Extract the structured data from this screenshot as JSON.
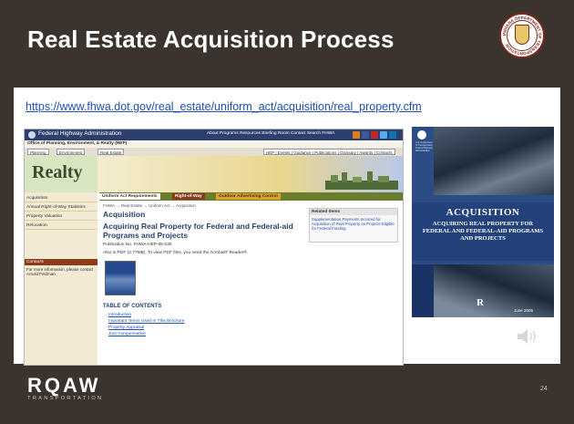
{
  "slide": {
    "title": "Real Estate Acquisition Process",
    "url": "https://www.fhwa.dot.gov/real_estate/uniform_act/acquisition/real_property.cfm",
    "page_number": "24",
    "footer_logo_text": "RQAW",
    "footer_tagline": "TRANSPORTATION",
    "seal_text": "INDIANA DEPARTMENT OF TRANSPORTATION"
  },
  "webpage": {
    "agency": "Federal Highway Administration",
    "top_links": "About  Programs  Resources  Briefing Room  Contact  Search FHWA",
    "office": "Office of Planning, Environment, & Realty (HEP)",
    "tabs": [
      "Planning",
      "Environment",
      "Real Estate"
    ],
    "right_tabs": "HEP | Events | Guidance | Publications | Glossary | Awards | Contacts",
    "banner_title": "Realty",
    "sidebar": [
      "Acquisition",
      "Annual Right-of-Way Statistics",
      "Property Valuation",
      "Relocation"
    ],
    "sidebar_contacts": "Contacts",
    "sidebar_note": "For more information, please contact Arnold Feldman",
    "subtabs": [
      "Uniform Act Requirements",
      "Right-of-Way",
      "Outdoor Advertising Control"
    ],
    "breadcrumb": "FHWA → Real Estate → Uniform Act → Acquisition",
    "heading": "Acquisition",
    "page_title": "Acquiring Real Property for Federal and Federal-aid Programs and Projects",
    "publication": "Publication No. FHWA-HEP-05-030",
    "also_in": "Also in PDF (2.77MB). To view PDF files, you need the Acrobat® Reader®.",
    "toc_title": "TABLE OF CONTENTS",
    "toc_items": [
      "Introduction",
      "Important Terms Used In This Brochure",
      "Property Appraisal",
      "Just Compensation"
    ],
    "related_title": "Related Items",
    "related_text": "Supplementation Payments Incurred for Acquisition of Real Property on Projects Eligible for Federal Funding"
  },
  "cover": {
    "title": "ACQUISITION",
    "subtitle": "ACQUIRING REAL PROPERTY FOR FEDERAL AND FEDERAL-AID PROGRAMS AND PROJECTS",
    "logo_caption": "U.S. Department of Transportation Federal Highway Administration",
    "letter": "R",
    "date": "June 2005"
  },
  "icons": {
    "speaker": "speaker-icon",
    "seal": "indot-seal-icon"
  },
  "colors": {
    "slide_bg": "#3a332e",
    "link": "#1f4fb8",
    "cover": "#2c4c86",
    "fhwa_bar": "#2d3f6e"
  }
}
